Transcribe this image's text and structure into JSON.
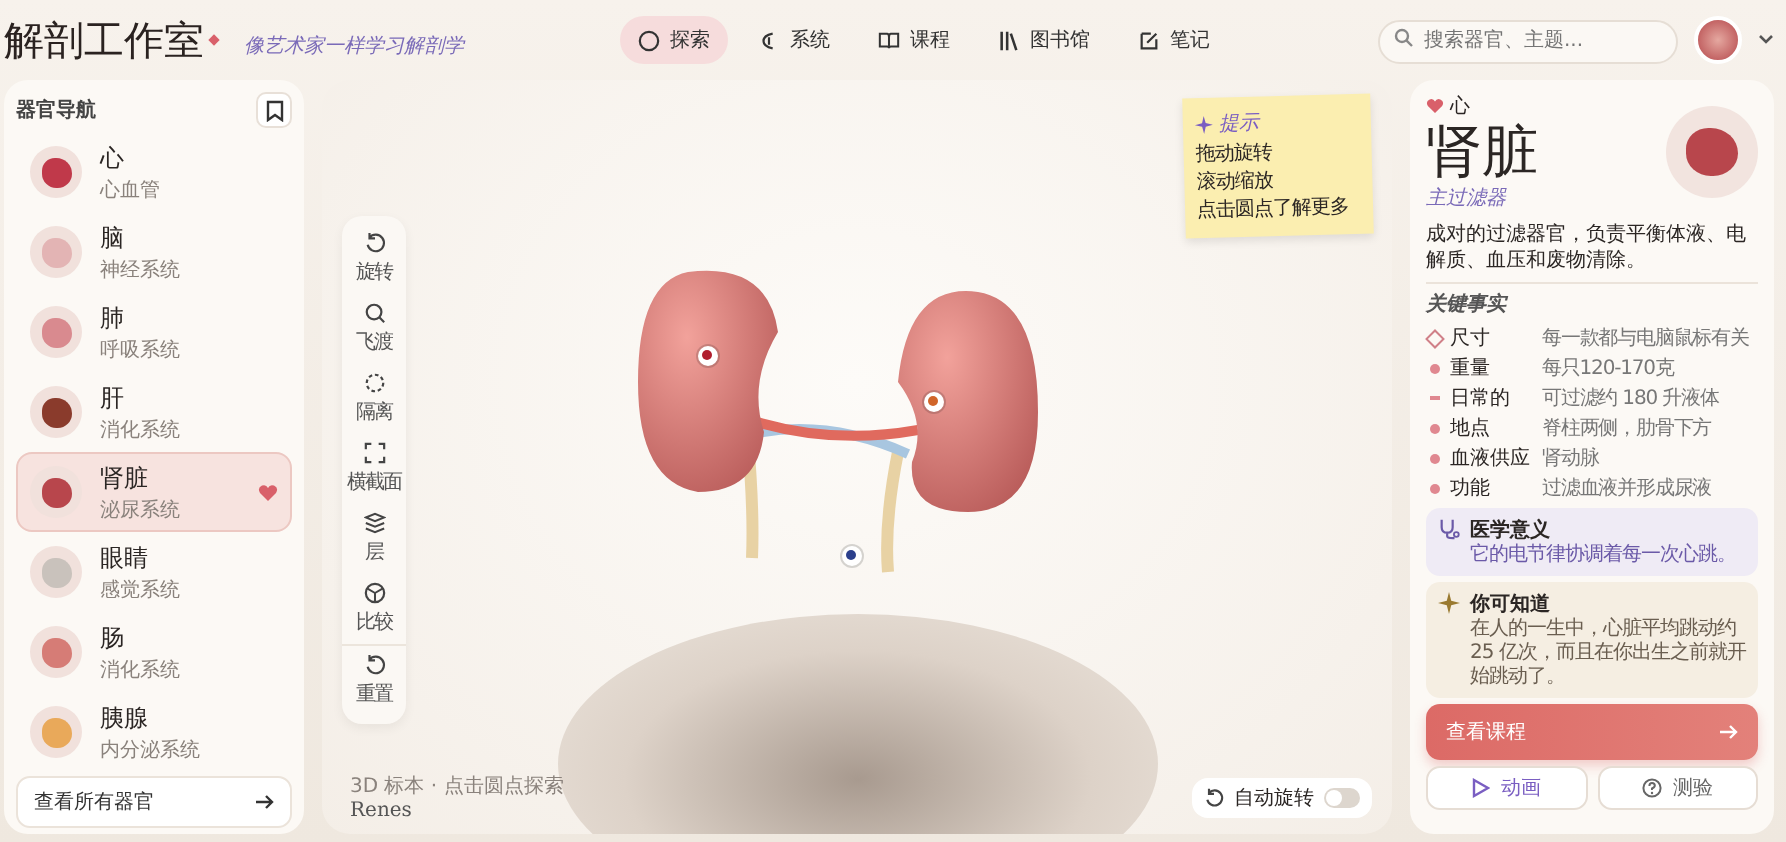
{
  "header": {
    "logo": "解剖工作室",
    "tagline": "像艺术家一样学习解剖学",
    "nav": [
      {
        "label": "探索",
        "selected": true
      },
      {
        "label": "系统",
        "selected": false
      },
      {
        "label": "课程",
        "selected": false
      },
      {
        "label": "图书馆",
        "selected": false
      },
      {
        "label": "笔记",
        "selected": false
      }
    ],
    "search": {
      "placeholder": "搜索器官、主题..."
    }
  },
  "sidebar": {
    "title": "器官导航",
    "items": [
      {
        "name": "心",
        "system": "心血管",
        "selected": false,
        "favorite": false
      },
      {
        "name": "脑",
        "system": "神经系统",
        "selected": false,
        "favorite": false
      },
      {
        "name": "肺",
        "system": "呼吸系统",
        "selected": false,
        "favorite": false
      },
      {
        "name": "肝",
        "system": "消化系统",
        "selected": false,
        "favorite": false
      },
      {
        "name": "肾脏",
        "system": "泌尿系统",
        "selected": true,
        "favorite": true
      },
      {
        "name": "眼睛",
        "system": "感觉系统",
        "selected": false,
        "favorite": false
      },
      {
        "name": "肠",
        "system": "消化系统",
        "selected": false,
        "favorite": false
      },
      {
        "name": "胰腺",
        "system": "内分泌系统",
        "selected": false,
        "favorite": false
      }
    ],
    "footer": "查看所有器官"
  },
  "viewer": {
    "tools": [
      "旋转",
      "飞渡",
      "隔离",
      "横截面",
      "层",
      "比较",
      "重置"
    ],
    "note": {
      "title": "提示",
      "lines": [
        "拖动旋转",
        "滚动缩放",
        "点击圆点了解更多"
      ]
    },
    "caption": "3D 标本 · 点击圆点探索",
    "latin_name": "Renes",
    "auto_rotate": {
      "label": "自动旋转",
      "on": false
    }
  },
  "details": {
    "breadcrumb": "心",
    "title": "肾脏",
    "subtitle": "主过滤器",
    "description": "成对的过滤器官，负责平衡体液、电解质、血压和废物清除。",
    "facts_title": "关键事实",
    "facts": [
      {
        "label": "尺寸",
        "value": "每一款都与电脑鼠标有关"
      },
      {
        "label": "重量",
        "value": "每只120-170克"
      },
      {
        "label": "日常的",
        "value": "可过滤约 180 升液体"
      },
      {
        "label": "地点",
        "value": "脊柱两侧，肋骨下方"
      },
      {
        "label": "血液供应",
        "value": "肾动脉"
      },
      {
        "label": "功能",
        "value": "过滤血液并形成尿液"
      }
    ],
    "clinical": {
      "title": "医学意义",
      "text": "它的电节律协调着每一次心跳。"
    },
    "trivia": {
      "title": "你可知道",
      "text": "在人的一生中，心脏平均跳动约 25 亿次，而且在你出生之前就开始跳动了。"
    },
    "primary_button": "查看课程",
    "buttons": [
      "动画",
      "测验"
    ]
  }
}
